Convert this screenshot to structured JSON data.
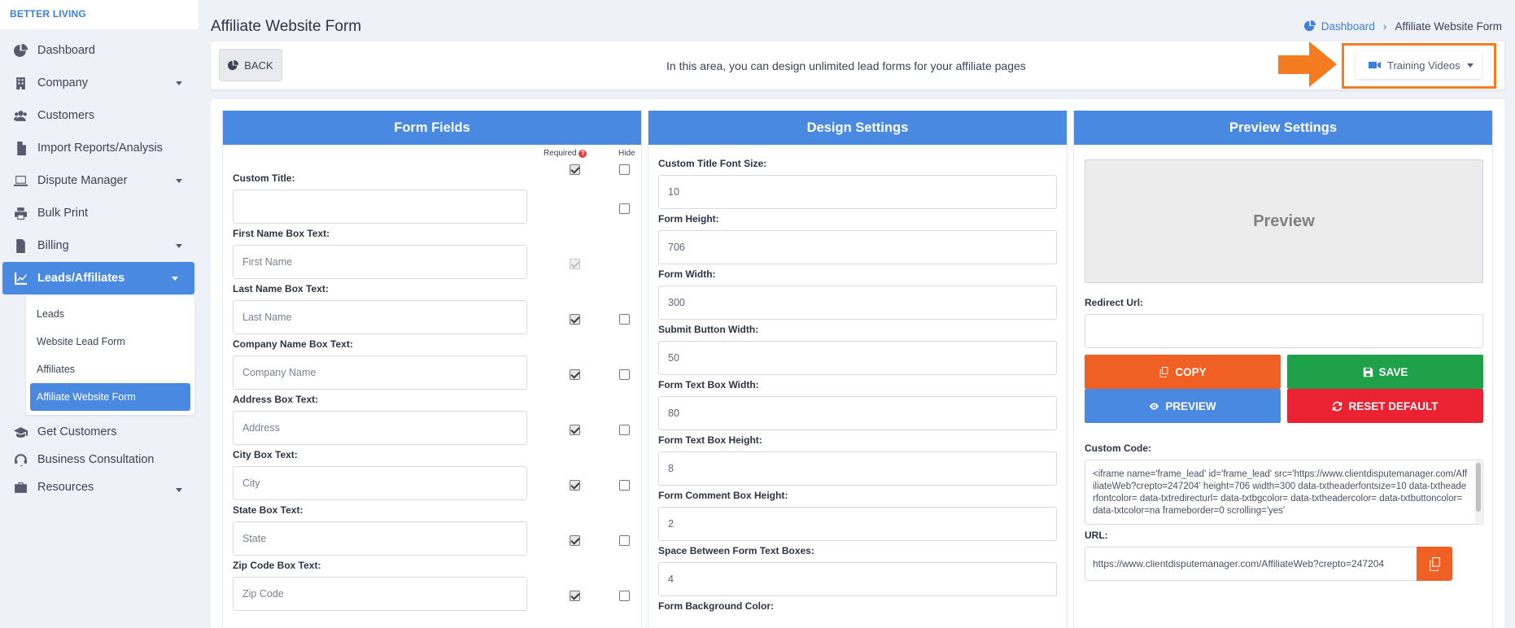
{
  "brand": "BETTER LIVING",
  "sidebar": {
    "items": [
      {
        "label": "Dashboard",
        "icon": "pie-chart-icon"
      },
      {
        "label": "Company",
        "icon": "building-icon"
      },
      {
        "label": "Customers",
        "icon": "users-icon"
      },
      {
        "label": "Import Reports/Analysis",
        "icon": "file-import-icon"
      },
      {
        "label": "Dispute Manager",
        "icon": "laptop-icon"
      },
      {
        "label": "Bulk Print",
        "icon": "print-icon"
      },
      {
        "label": "Billing",
        "icon": "invoice-icon"
      },
      {
        "label": "Leads/Affiliates",
        "icon": "chart-line-icon"
      },
      {
        "label": "Get Customers",
        "icon": "graduation-cap-icon"
      },
      {
        "label": "Business Consultation",
        "icon": "headset-icon"
      },
      {
        "label": "Resources",
        "icon": "briefcase-icon"
      }
    ],
    "submenu": [
      "Leads",
      "Website Lead Form",
      "Affiliates",
      "Affiliate Website Form"
    ]
  },
  "header": {
    "title": "Affiliate Website Form",
    "breadcrumb_home": "Dashboard",
    "breadcrumb_current": "Affiliate Website Form"
  },
  "topbar": {
    "back_label": "BACK",
    "info": "In this area, you can design unlimited lead forms for your affiliate pages",
    "training_label": "Training Videos",
    "highlight_color": "#f47b20"
  },
  "form_fields": {
    "heading": "Form Fields",
    "required_label": "Required",
    "hide_label": "Hide",
    "fields": [
      {
        "label": "Custom Title:",
        "placeholder": ""
      },
      {
        "label": "First Name Box Text:",
        "placeholder": "First Name"
      },
      {
        "label": "Last Name Box Text:",
        "placeholder": "Last Name"
      },
      {
        "label": "Company Name Box Text:",
        "placeholder": "Company Name"
      },
      {
        "label": "Address Box Text:",
        "placeholder": "Address"
      },
      {
        "label": "City Box Text:",
        "placeholder": "City"
      },
      {
        "label": "State Box Text:",
        "placeholder": "State"
      },
      {
        "label": "Zip Code Box Text:",
        "placeholder": "Zip Code"
      }
    ]
  },
  "design": {
    "heading": "Design Settings",
    "fields": [
      {
        "label": "Custom Title Font Size:",
        "value": "10"
      },
      {
        "label": "Form Height:",
        "value": "706"
      },
      {
        "label": "Form Width:",
        "value": "300"
      },
      {
        "label": "Submit Button Width:",
        "value": "50"
      },
      {
        "label": "Form Text Box Width:",
        "value": "80"
      },
      {
        "label": "Form Text Box Height:",
        "value": "8"
      },
      {
        "label": "Form Comment Box Height:",
        "value": "2"
      },
      {
        "label": "Space Between Form Text Boxes:",
        "value": "4"
      },
      {
        "label": "Form Background Color:",
        "value": ""
      }
    ]
  },
  "preview": {
    "heading": "Preview Settings",
    "preview_text": "Preview",
    "redirect_label": "Redirect Url:",
    "copy": "COPY",
    "save": "SAVE",
    "preview_btn": "PREVIEW",
    "reset": "RESET DEFAULT",
    "custom_code_label": "Custom Code:",
    "custom_code": "<iframe name='frame_lead' id='frame_lead' src='https://www.clientdisputemanager.com/AffiliateWeb?crepto=247204' height=706 width=300 data-txtheaderfontsize=10 data-txtheaderfontcolor= data-txtredirecturl= data-txtbgcolor= data-txtheadercolor= data-txtbuttoncolor= data-txtcolor=na frameborder=0  scrolling='yes'",
    "url_label": "URL:",
    "url": "https://www.clientdisputemanager.com/AffiliateWeb?crepto=247204"
  }
}
